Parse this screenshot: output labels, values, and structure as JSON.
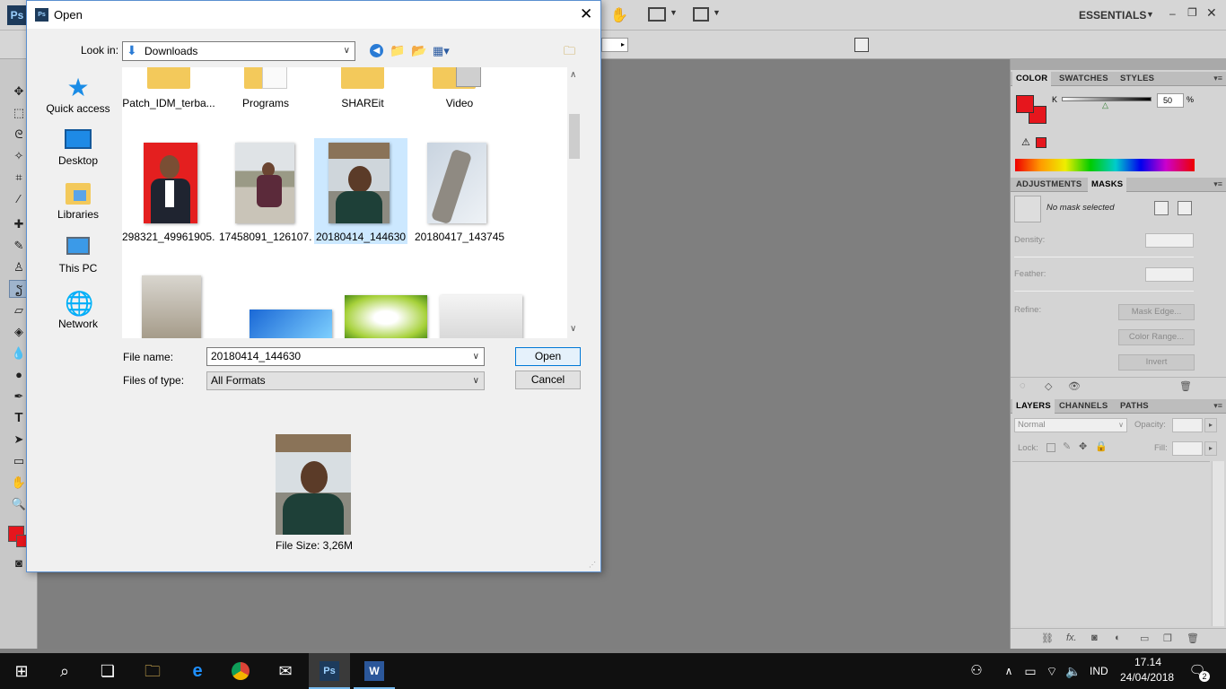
{
  "photoshop": {
    "logo": "Ps",
    "workspace": "ESSENTIALS",
    "color_panel": {
      "tabs": [
        "COLOR",
        "SWATCHES",
        "STYLES"
      ],
      "channel_label": "K",
      "channel_value": "50",
      "percent": "%",
      "foreground": "#e6161d",
      "background": "#e6161d"
    },
    "masks_panel": {
      "tabs": [
        "ADJUSTMENTS",
        "MASKS"
      ],
      "status": "No mask selected",
      "density_label": "Density:",
      "feather_label": "Feather:",
      "refine_label": "Refine:",
      "buttons": [
        "Mask Edge...",
        "Color Range...",
        "Invert"
      ]
    },
    "layers_panel": {
      "tabs": [
        "LAYERS",
        "CHANNELS",
        "PATHS"
      ],
      "blend_mode": "Normal",
      "opacity_label": "Opacity:",
      "lock_label": "Lock:",
      "fill_label": "Fill:"
    }
  },
  "dialog": {
    "title": "Open",
    "look_in_label": "Look in:",
    "look_in_value": "Downloads",
    "places": [
      "Quick access",
      "Desktop",
      "Libraries",
      "This PC",
      "Network"
    ],
    "folders": [
      "Patch_IDM_terba...",
      "Programs",
      "SHAREit",
      "Video"
    ],
    "images": [
      "298321_49961905...",
      "17458091_126107...",
      "20180414_144630",
      "20180417_143745"
    ],
    "selected_file": "20180414_144630",
    "file_name_label": "File name:",
    "file_name_value": "20180414_144630",
    "files_of_type_label": "Files of type:",
    "files_of_type_value": "All Formats",
    "open_button": "Open",
    "cancel_button": "Cancel",
    "preview_file_size": "File Size: 3,26M"
  },
  "taskbar": {
    "language": "IND",
    "time": "17.14",
    "date": "24/04/2018",
    "notification_count": "2"
  }
}
